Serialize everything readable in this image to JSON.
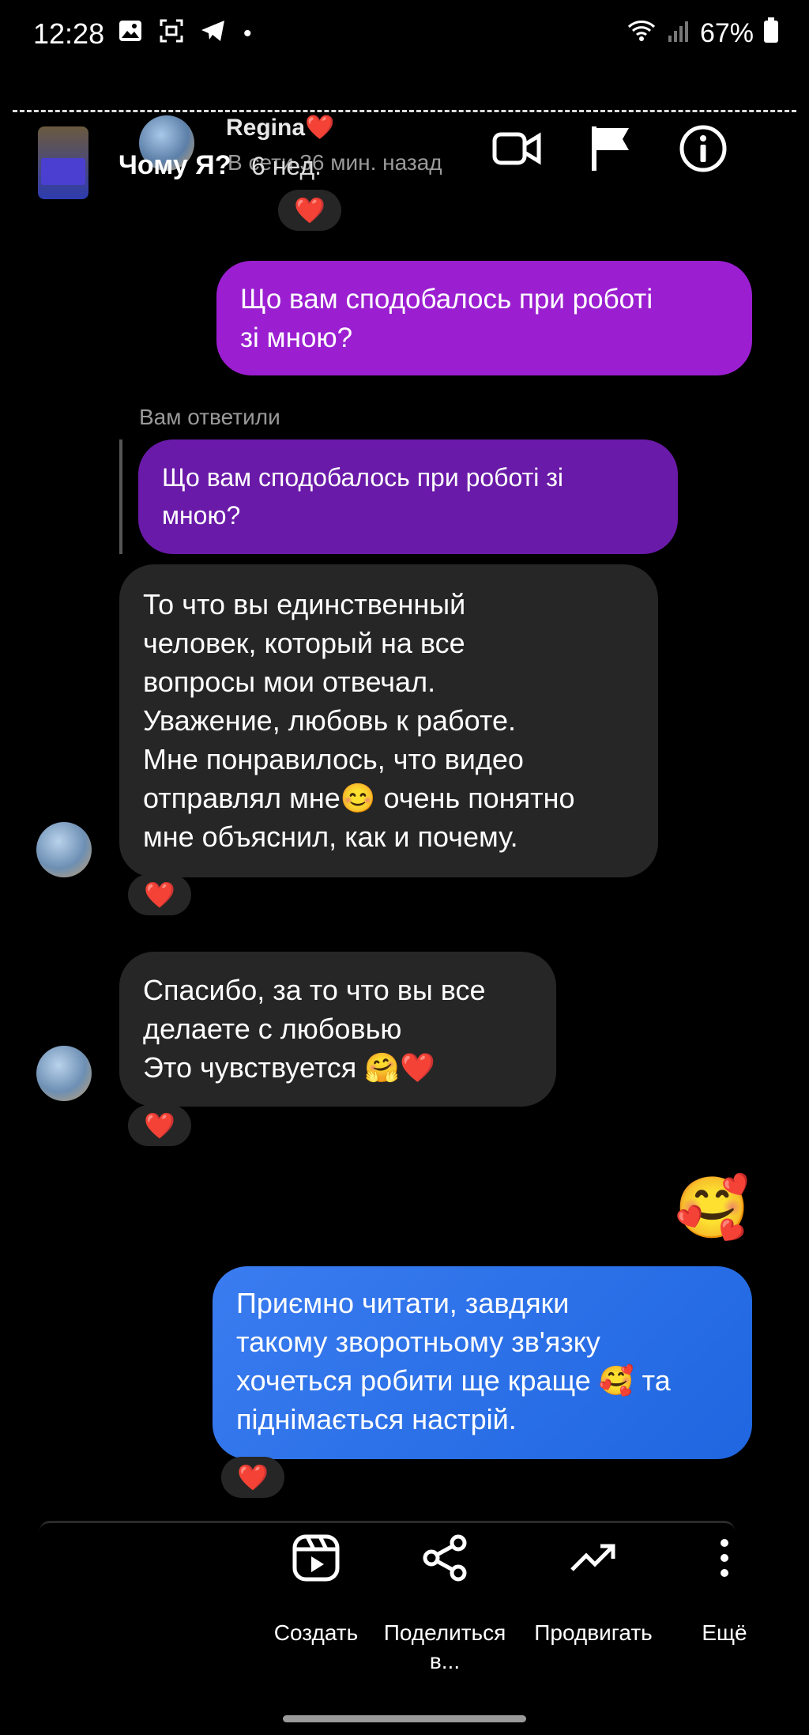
{
  "status_bar": {
    "time": "12:28",
    "battery": "67%"
  },
  "reel_header": {
    "title": "Чому Я?",
    "age": "6 нед."
  },
  "chat_header": {
    "name": "Regina❤️",
    "status": "В сети 36 мин. назад"
  },
  "messages": [
    {
      "side": "right",
      "style": "purple",
      "text_lines": [
        "Що вам сподобалось при роботі",
        "зі мною?"
      ]
    },
    {
      "reply_label": "Вам ответили",
      "quoted_lines": [
        "Що вам сподобалось при роботі зі",
        "мною?"
      ]
    },
    {
      "side": "left",
      "style": "dark",
      "text_lines": [
        "То что вы единственный",
        "человек, который на все",
        "вопросы мои отвечал.",
        "Уважение, любовь к работе.",
        "Мне понравилось, что видео",
        "отправлял мне😊 очень понятно",
        "мне объяснил, как и почему."
      ],
      "reaction": "❤️"
    },
    {
      "side": "left",
      "style": "dark",
      "text_lines": [
        "Спасибо, за то что вы все",
        "делаете с любовью",
        "Это чувствуется 🤗❤️"
      ],
      "reaction": "❤️"
    },
    {
      "side": "right",
      "style": "emoji",
      "text": "🥰"
    },
    {
      "side": "right",
      "style": "blue",
      "text_lines": [
        "Приємно читати, завдяки",
        "такому зворотньому зв'язку",
        "хочеться робити ще краще 🥰 та",
        "піднімається настрій."
      ],
      "reaction": "❤️"
    }
  ],
  "top_reaction": "❤️",
  "actions": [
    {
      "label": "Создать",
      "icon": "reels-icon"
    },
    {
      "label": "Поделиться в...",
      "icon": "share-icon"
    },
    {
      "label": "Продвигать",
      "icon": "trending-icon"
    },
    {
      "label": "Ещё",
      "icon": "more-icon"
    }
  ]
}
